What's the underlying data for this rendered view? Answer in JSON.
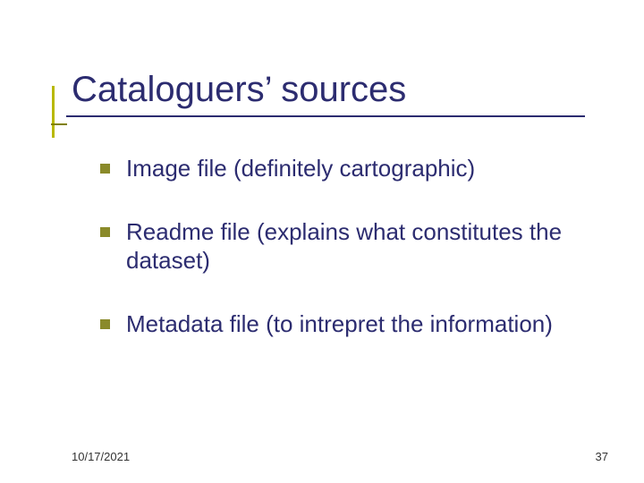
{
  "slide": {
    "title": "Cataloguers’ sources",
    "bullets": [
      "Image file (definitely cartographic)",
      "Readme file (explains what constitutes the dataset)",
      "Metadata file (to intrepret the information)"
    ],
    "footer_date": "10/17/2021",
    "page_number": "37"
  }
}
